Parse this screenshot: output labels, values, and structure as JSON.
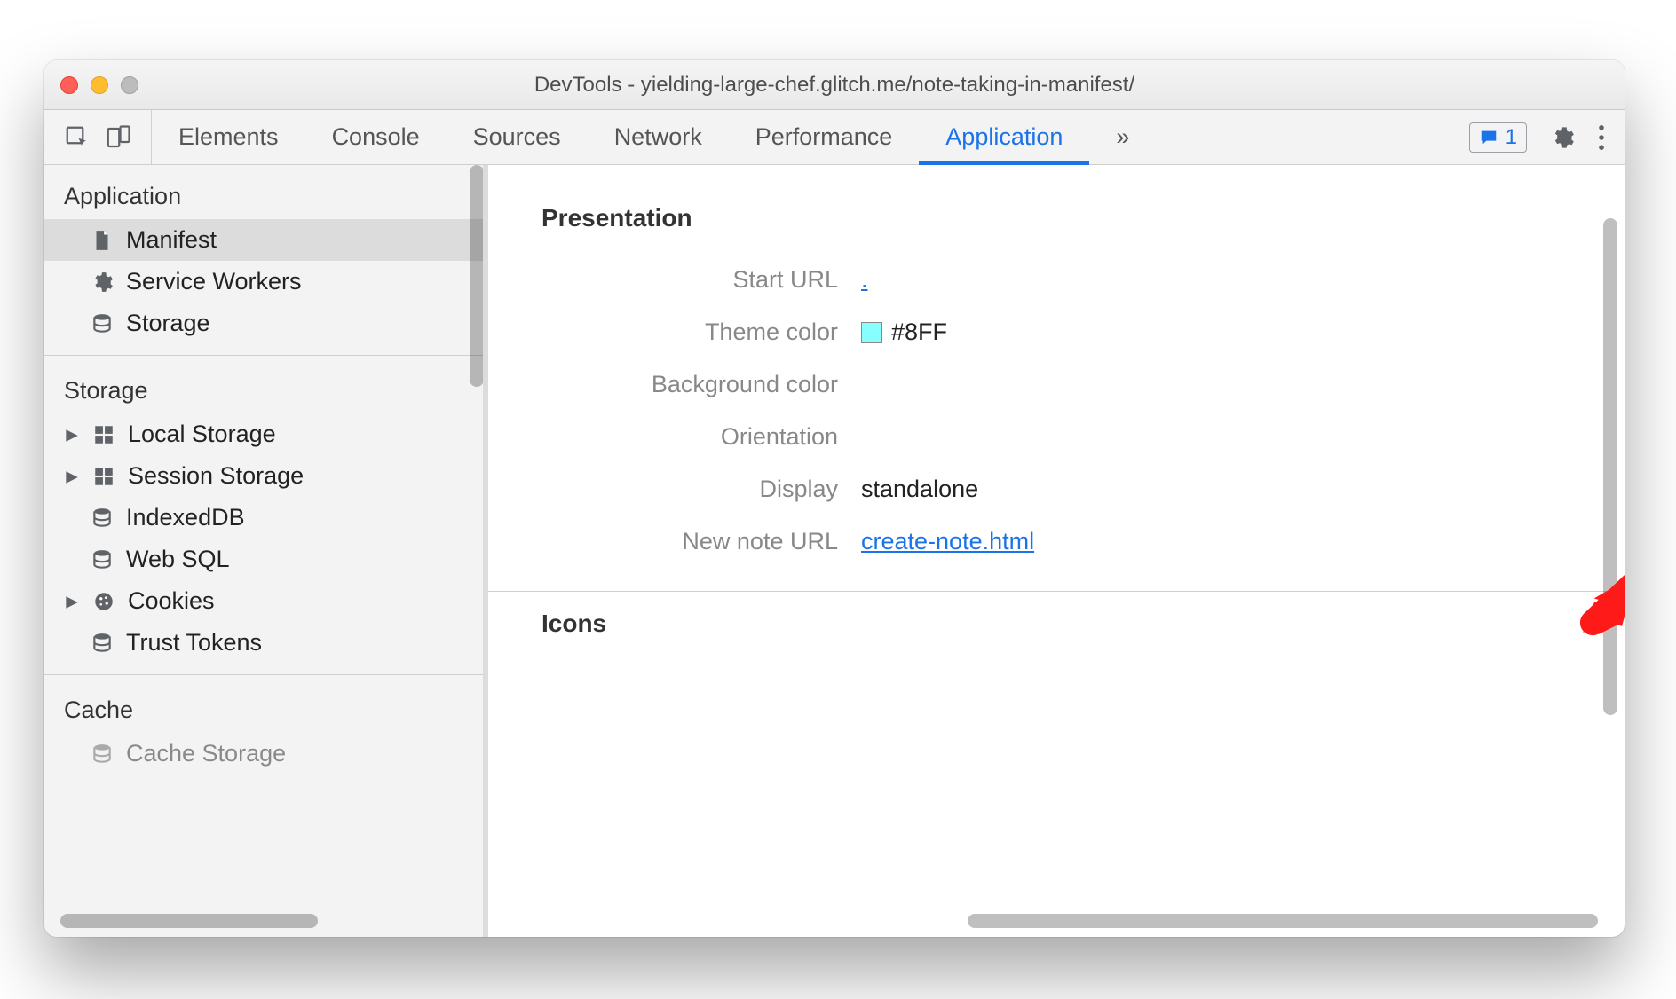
{
  "window": {
    "title": "DevTools - yielding-large-chef.glitch.me/note-taking-in-manifest/"
  },
  "tabs": {
    "items": [
      "Elements",
      "Console",
      "Sources",
      "Network",
      "Performance",
      "Application"
    ],
    "active": "Application",
    "overflow_glyph": "»"
  },
  "badge": {
    "count": "1"
  },
  "sidebar": {
    "sections": [
      {
        "title": "Application",
        "items": [
          {
            "label": "Manifest",
            "icon": "file",
            "selected": true
          },
          {
            "label": "Service Workers",
            "icon": "gear"
          },
          {
            "label": "Storage",
            "icon": "db"
          }
        ]
      },
      {
        "title": "Storage",
        "items": [
          {
            "label": "Local Storage",
            "icon": "grid",
            "expandable": true
          },
          {
            "label": "Session Storage",
            "icon": "grid",
            "expandable": true
          },
          {
            "label": "IndexedDB",
            "icon": "db"
          },
          {
            "label": "Web SQL",
            "icon": "db"
          },
          {
            "label": "Cookies",
            "icon": "cookie",
            "expandable": true
          },
          {
            "label": "Trust Tokens",
            "icon": "db"
          }
        ]
      },
      {
        "title": "Cache",
        "items": [
          {
            "label": "Cache Storage",
            "icon": "db"
          }
        ]
      }
    ]
  },
  "manifest": {
    "presentation_heading": "Presentation",
    "icons_heading": "Icons",
    "rows": {
      "start_url": {
        "label": "Start URL",
        "value": "."
      },
      "theme_color": {
        "label": "Theme color",
        "value": "#8FF",
        "swatch": "#88ffff"
      },
      "background_color": {
        "label": "Background color",
        "value": ""
      },
      "orientation": {
        "label": "Orientation",
        "value": ""
      },
      "display": {
        "label": "Display",
        "value": "standalone"
      },
      "new_note_url": {
        "label": "New note URL",
        "value": "create-note.html"
      }
    }
  }
}
